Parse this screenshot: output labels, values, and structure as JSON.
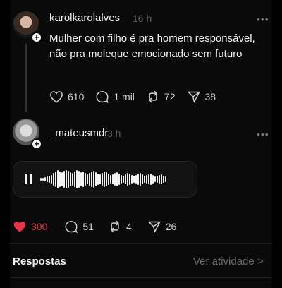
{
  "post": {
    "username": "karolkarolalves",
    "time": "16 h",
    "text": "Mulher com filho é pra homem responsável, não pra moleque emocionado sem futuro",
    "likes": "610",
    "comments": "1 mil",
    "reposts": "72",
    "shares": "38",
    "more": "•••"
  },
  "reply": {
    "username": "_mateusmdr",
    "time": "3 h",
    "more": "•••",
    "likes": "300",
    "comments": "51",
    "reposts": "4",
    "shares": "26"
  },
  "footer": {
    "replies_label": "Respostas",
    "activity_label": "Ver atividade >"
  },
  "colors": {
    "like_active": "#e8344a",
    "background": "#0a0a0a",
    "muted": "#5e5e5e"
  },
  "icons": [
    "heart-icon",
    "comment-icon",
    "repost-icon",
    "share-icon",
    "pause-icon",
    "follow-plus-icon"
  ]
}
